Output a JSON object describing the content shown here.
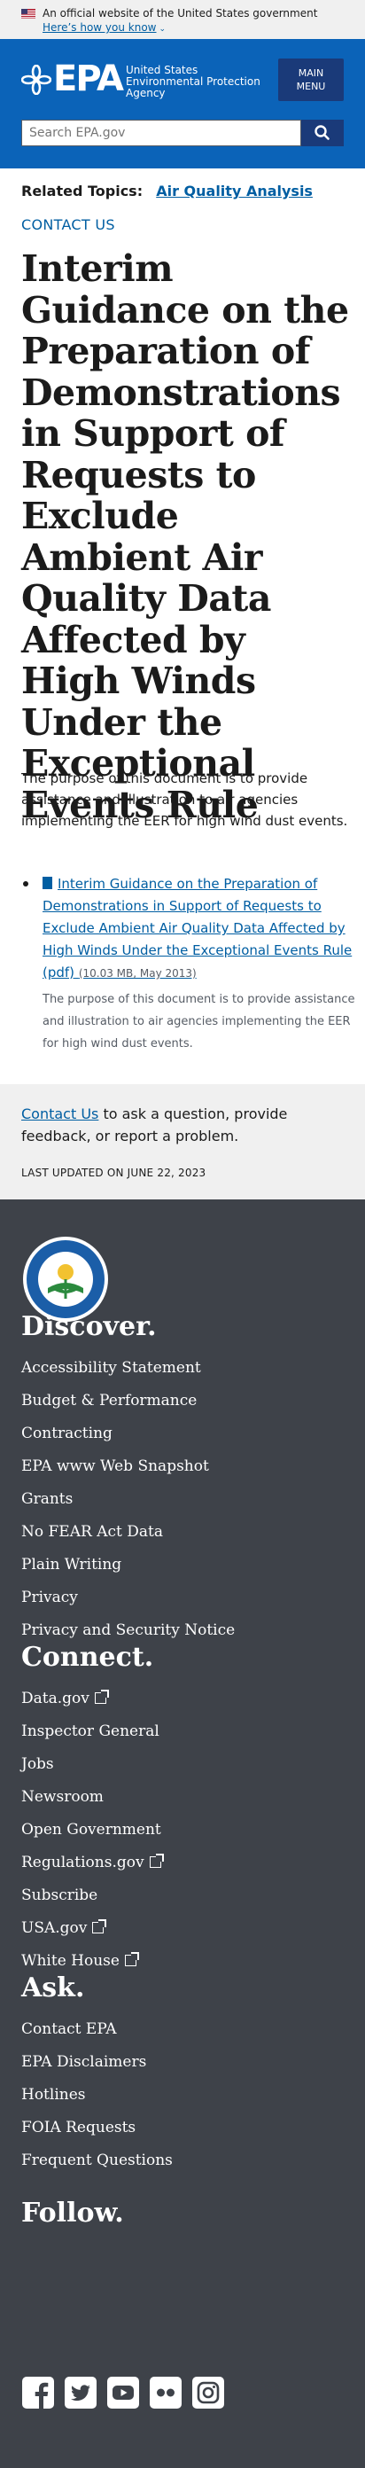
{
  "gov_banner": {
    "official_text": "An official website of the United States government",
    "how_you_know": "Here’s how you know"
  },
  "header": {
    "logo_text": "EPA",
    "agency_line1": "United States",
    "agency_line2": "Environmental Protection",
    "agency_line3": "Agency",
    "menu_line1": "MAIN",
    "menu_line2": "MENU",
    "search_placeholder": "Search EPA.gov"
  },
  "main": {
    "related_label": "Related Topics:",
    "related_topic": "Air Quality Analysis",
    "contact_us": "CONTACT US",
    "title": "Interim Guidance on the Preparation of Demonstrations in Support of Requests to Exclude Ambient Air Quality Data Affected by High Winds Under the Exceptional Events Rule",
    "intro": "The purpose of this document is to provide assistance and illustration to air agencies implementing the EER for high wind dust events.",
    "document": {
      "link_text": "Interim Guidance on the Preparation of Demonstrations in Support of Requests to Exclude Ambient Air Quality Data Affected by High Winds Under the Exceptional Events Rule (pdf)",
      "meta": "(10.03 MB, May 2013)",
      "description": "The purpose of this document is to provide assistance and illustration to air agencies implementing the EER for high wind dust events."
    }
  },
  "contact_box": {
    "link": "Contact Us",
    "text": " to ask a question, provide feedback, or report a problem.",
    "last_updated": "LAST UPDATED ON JUNE 22, 2023"
  },
  "footer": {
    "discover": {
      "heading": "Discover.",
      "links": [
        "Accessibility Statement",
        "Budget & Performance",
        "Contracting",
        "EPA www Web Snapshot",
        "Grants",
        "No FEAR Act Data",
        "Plain Writing",
        "Privacy",
        "Privacy and Security Notice"
      ]
    },
    "connect": {
      "heading": "Connect.",
      "links": [
        "Data.gov",
        "Inspector General",
        "Jobs",
        "Newsroom",
        "Open Government",
        "Regulations.gov",
        "Subscribe",
        "USA.gov",
        "White House"
      ]
    },
    "ask": {
      "heading": "Ask.",
      "links": [
        "Contact EPA",
        "EPA Disclaimers",
        "Hotlines",
        "FOIA Requests",
        "Frequent Questions"
      ]
    },
    "follow": {
      "heading": "Follow.",
      "social": [
        "facebook-icon",
        "twitter-icon",
        "youtube-icon",
        "flickr-icon",
        "instagram-icon"
      ]
    }
  },
  "colors": {
    "header_blue": "#0b63b8",
    "menu_navy": "#1a3a79",
    "link_blue": "#005ea2",
    "footer_bg": "#3e4249"
  }
}
